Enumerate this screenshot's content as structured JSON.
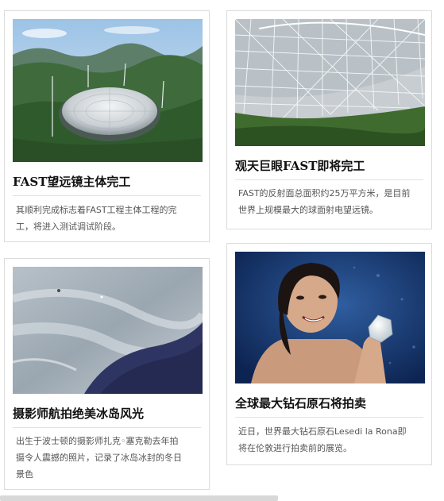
{
  "cards": [
    {
      "title": "FAST望远镜主体完工",
      "desc_lines": [
        "其顺利完成标志着FAST工程主体工程的完",
        "工，将进入测试调试阶段。"
      ],
      "image": "radio-telescope-dish-in-mountains"
    },
    {
      "title": "观天巨眼FAST即将完工",
      "desc_lines": [
        "FAST的反射面总面积约25万平方米，是目前",
        "世界上规模最大的球面射电望远镜。"
      ],
      "image": "telescope-cable-structure-closeup"
    },
    {
      "title": "摄影师航拍绝美冰岛风光",
      "desc_lines": [
        "出生于波士顿的摄影师扎克◦塞克勒去年拍",
        "摄令人震撼的照片，记录了冰岛冰封的冬日",
        "景色"
      ],
      "image": "iceland-aerial-frozen-landscape"
    },
    {
      "title": "全球最大钻石原石将拍卖",
      "desc_lines": [
        "近日，世界最大钻石原石Lesedi la Rona即",
        "将在伦敦进行拍卖前的展览。"
      ],
      "image": "woman-holding-rough-diamond"
    }
  ],
  "colors": {
    "card_border": "#dcdcdc",
    "title": "#111111",
    "desc": "#555555"
  }
}
